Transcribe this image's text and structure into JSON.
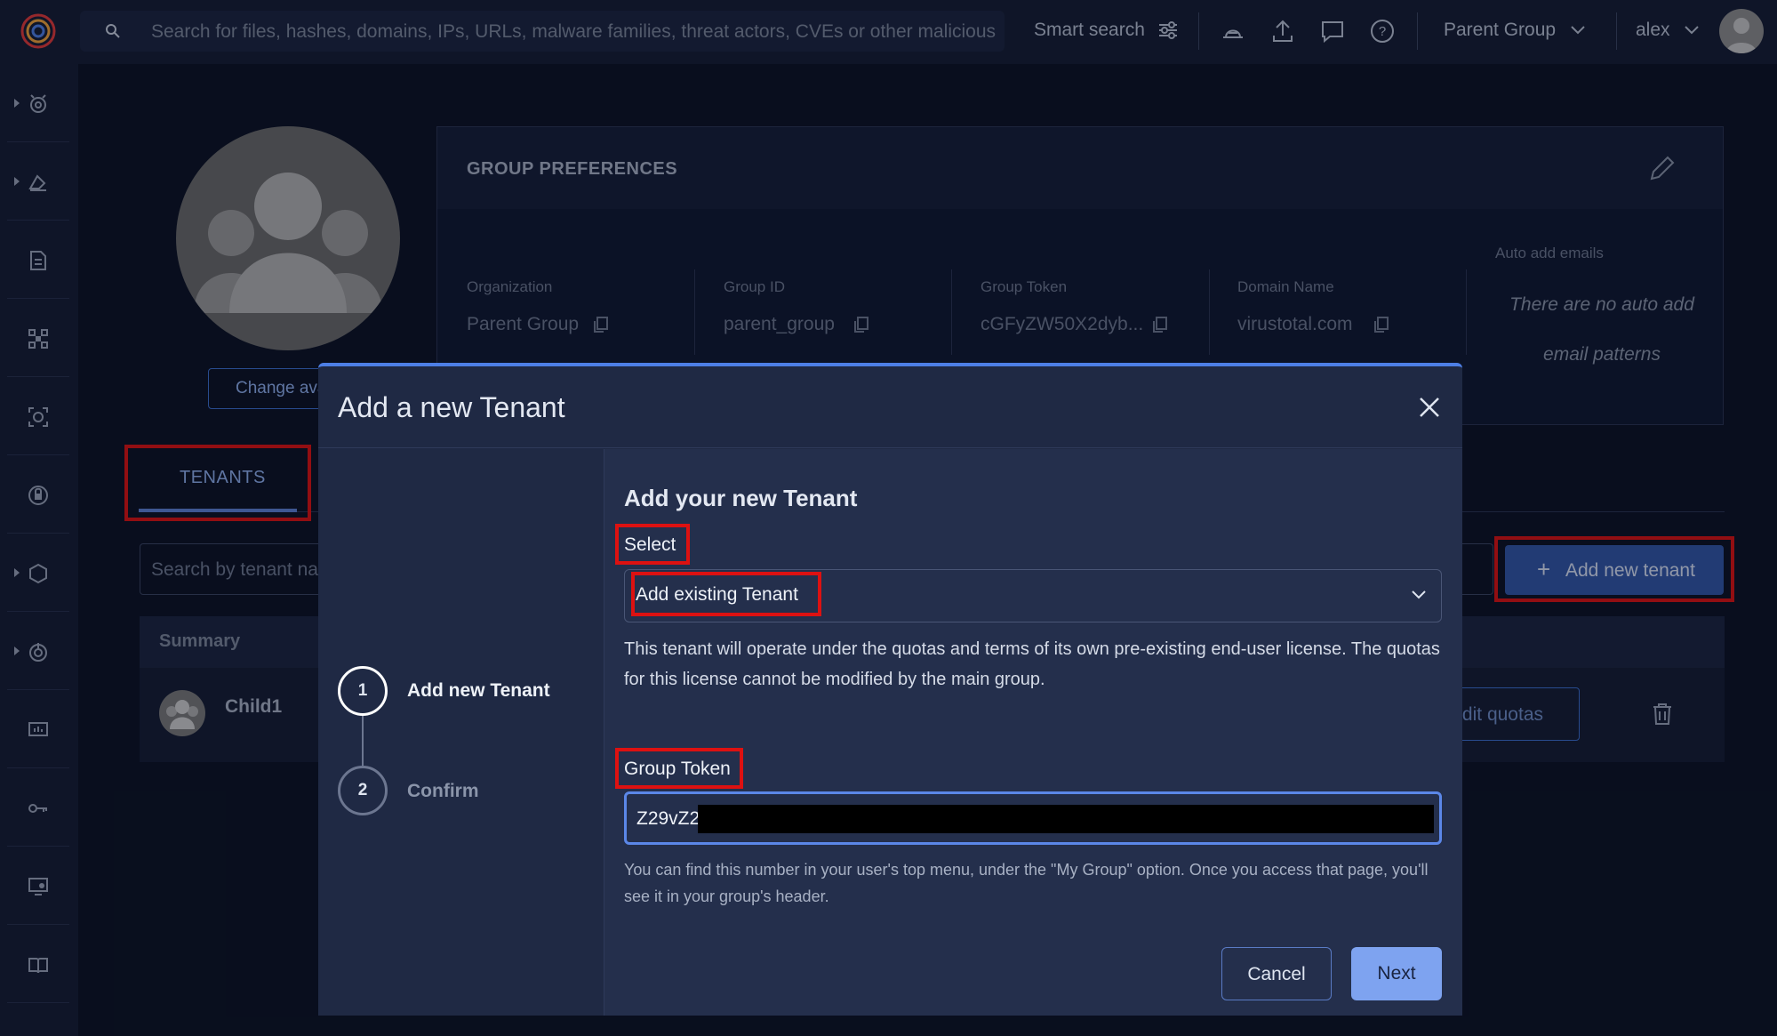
{
  "topbar": {
    "search_placeholder": "Search for files, hashes, domains, IPs, URLs, malware families, threat actors, CVEs or other malicious c",
    "smart_search_label": "Smart search",
    "group_selector": "Parent Group",
    "user_name": "alex",
    "icons": [
      "search-icon",
      "filter-sliders-icon",
      "detection-icon",
      "upload-icon",
      "chat-icon",
      "help-icon",
      "chevron-down-icon"
    ]
  },
  "sidebar": {
    "icons": [
      "threat-hunting-icon",
      "hunting-icon",
      "reports-icon",
      "graph-icon",
      "scan-icon",
      "intelligence-icon",
      "collections-icon",
      "monitor-icon",
      "dashboard-icon",
      "api-key-icon",
      "admin-icon",
      "docs-icon"
    ]
  },
  "profile": {
    "change_avatar_label": "Change avatar"
  },
  "group_preferences": {
    "title": "GROUP PREFERENCES",
    "fields": [
      {
        "label": "Organization",
        "value": "Parent Group"
      },
      {
        "label": "Group ID",
        "value": "parent_group"
      },
      {
        "label": "Group Token",
        "value": "cGFyZW50X2dyb..."
      },
      {
        "label": "Domain Name",
        "value": "virustotal.com"
      }
    ],
    "auto_add_label": "Auto add emails",
    "auto_add_value": "There are no auto add email patterns"
  },
  "tenants": {
    "tab_label": "TENANTS",
    "search_placeholder": "Search by tenant name",
    "add_button_label": "Add new tenant",
    "column_summary": "Summary",
    "rows": [
      {
        "name": "Child1",
        "edit_label": "Edit quotas"
      }
    ]
  },
  "modal": {
    "title": "Add a new Tenant",
    "steps": [
      {
        "number": "1",
        "label": "Add new Tenant"
      },
      {
        "number": "2",
        "label": "Confirm"
      }
    ],
    "heading": "Add your new Tenant",
    "select_label": "Select",
    "select_value": "Add existing Tenant",
    "description": "This tenant will operate under the quotas and terms of its own pre-existing end-user license. The quotas for this license cannot be modified by the main group.",
    "token_label": "Group Token",
    "token_value": "Z29vZ2",
    "token_help": "You can find this number in your user's top menu, under the \"My Group\" option. Once you access that page, you'll see it in your group's header.",
    "cancel_label": "Cancel",
    "next_label": "Next"
  },
  "colors": {
    "accent": "#4d7fe6",
    "highlight": "#dd1111",
    "background": "#0b1224",
    "panel": "#151d33"
  }
}
